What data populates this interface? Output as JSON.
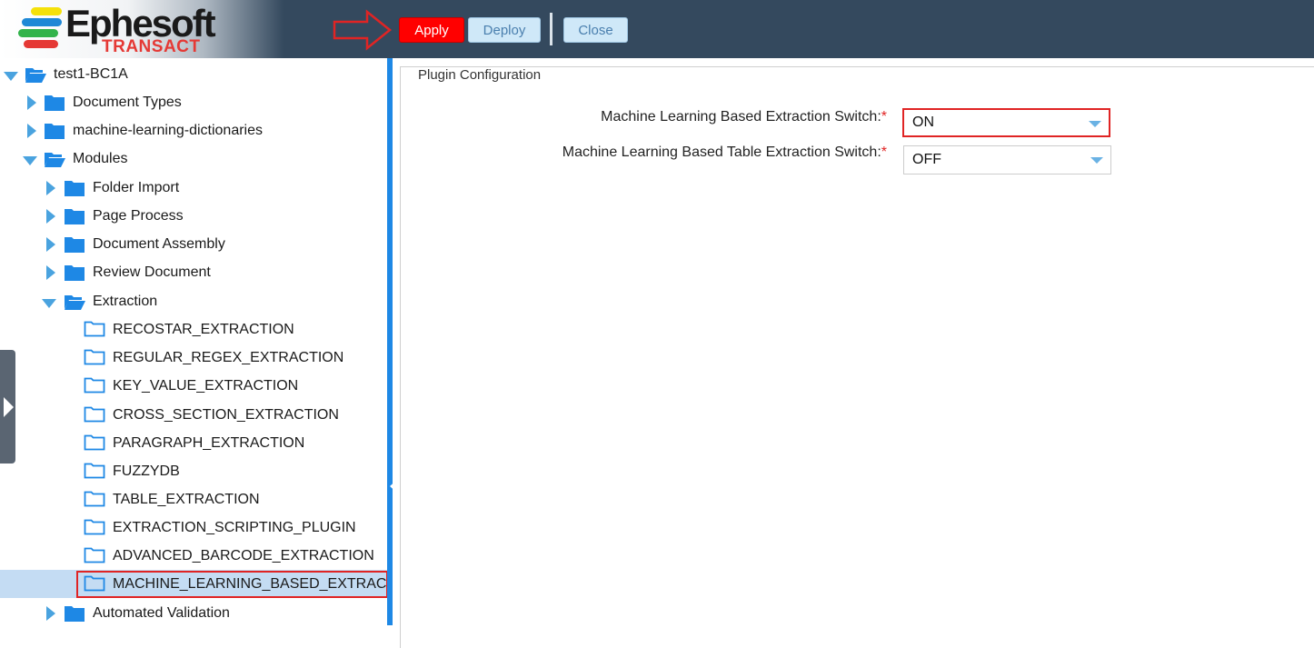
{
  "brand": {
    "name": "Ephesoft",
    "product": "TRANSACT"
  },
  "toolbar": {
    "apply_label": "Apply",
    "deploy_label": "Deploy",
    "close_label": "Close"
  },
  "tree": {
    "root": "test1-BC1A",
    "document_types": "Document Types",
    "ml_dictionaries": "machine-learning-dictionaries",
    "modules": "Modules",
    "folder_import": "Folder Import",
    "page_process": "Page Process",
    "document_assembly": "Document Assembly",
    "review_document": "Review Document",
    "extraction": "Extraction",
    "plugins": [
      "RECOSTAR_EXTRACTION",
      "REGULAR_REGEX_EXTRACTION",
      "KEY_VALUE_EXTRACTION",
      "CROSS_SECTION_EXTRACTION",
      "PARAGRAPH_EXTRACTION",
      "FUZZYDB",
      "TABLE_EXTRACTION",
      "EXTRACTION_SCRIPTING_PLUGIN",
      "ADVANCED_BARCODE_EXTRACTION",
      "MACHINE_LEARNING_BASED_EXTRAC"
    ],
    "automated_validation": "Automated Validation"
  },
  "config": {
    "legend": "Plugin Configuration",
    "ml_switch_label": "Machine Learning Based Extraction Switch:",
    "ml_switch_value": "ON",
    "ml_table_switch_label": "Machine Learning Based Table Extraction Switch:",
    "ml_table_switch_value": "OFF",
    "required_mark": "*"
  },
  "colors": {
    "header": "#34495e",
    "accent": "#1e88e5",
    "apply": "#ff0000",
    "highlight": "#e02424"
  }
}
